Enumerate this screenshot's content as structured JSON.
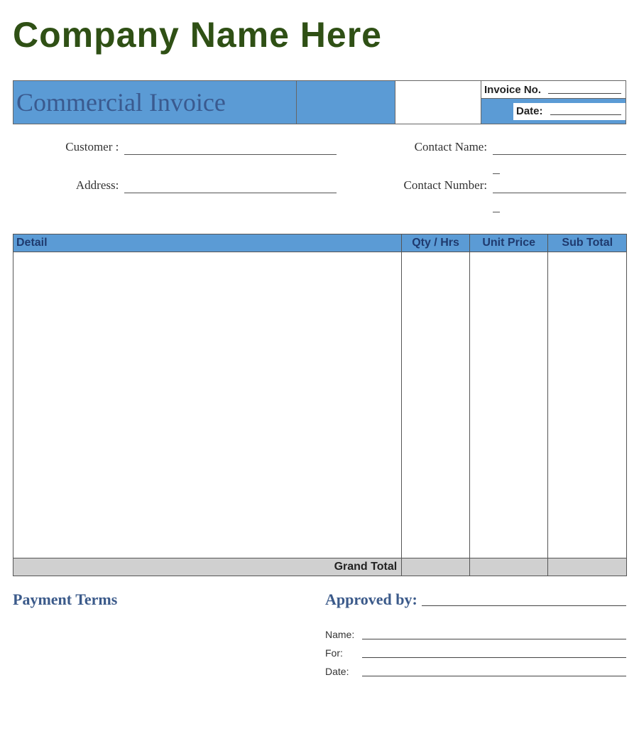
{
  "company_name": "Company Name Here",
  "invoice_title": "Commercial Invoice",
  "header": {
    "invoice_no_label": "Invoice No.",
    "invoice_no_value": "",
    "date_label": "Date:",
    "date_value": ""
  },
  "fields": {
    "customer_label": "Customer :",
    "customer_value": "",
    "address_label": "Address:",
    "address_value": "",
    "contact_name_label": "Contact Name:",
    "contact_name_value": "",
    "contact_number_label": "Contact Number:",
    "contact_number_value": ""
  },
  "columns": {
    "detail": "Detail",
    "qty": "Qty / Hrs",
    "unit_price": "Unit Price",
    "sub_total": "Sub Total"
  },
  "grand_total_label": "Grand Total",
  "grand_total_value": "",
  "footer": {
    "payment_terms": "Payment Terms",
    "approved_by": "Approved by:",
    "name_label": "Name:",
    "for_label": "For:",
    "date_label": "Date:"
  }
}
